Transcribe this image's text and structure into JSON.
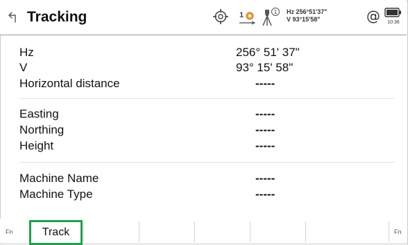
{
  "header": {
    "title": "Tracking",
    "prism_constant": "1",
    "tripod_badge": "1",
    "hz_angle": "Hz 256°51'37\"",
    "v_angle": "V  93°15'58\"",
    "time": "10:36",
    "icons": [
      "back-icon",
      "target-icon",
      "prism-icon",
      "tripod-icon",
      "at-icon",
      "battery-icon"
    ]
  },
  "measurements": {
    "hz": {
      "label": "Hz",
      "value": "256° 51' 37\""
    },
    "v": {
      "label": "V",
      "value": "93° 15' 58\""
    },
    "horizontal_distance": {
      "label": "Horizontal distance",
      "value": "-----"
    }
  },
  "coordinates": {
    "easting": {
      "label": "Easting",
      "value": "-----"
    },
    "northing": {
      "label": "Northing",
      "value": "-----"
    },
    "height": {
      "label": "Height",
      "value": "-----"
    }
  },
  "machine": {
    "name": {
      "label": "Machine Name",
      "value": "-----"
    },
    "type": {
      "label": "Machine Type",
      "value": "-----"
    }
  },
  "footer": {
    "fn_left": "Fn",
    "fn_right": "Fn",
    "track_label": "Track",
    "highlight_color": "#1aa34a"
  }
}
